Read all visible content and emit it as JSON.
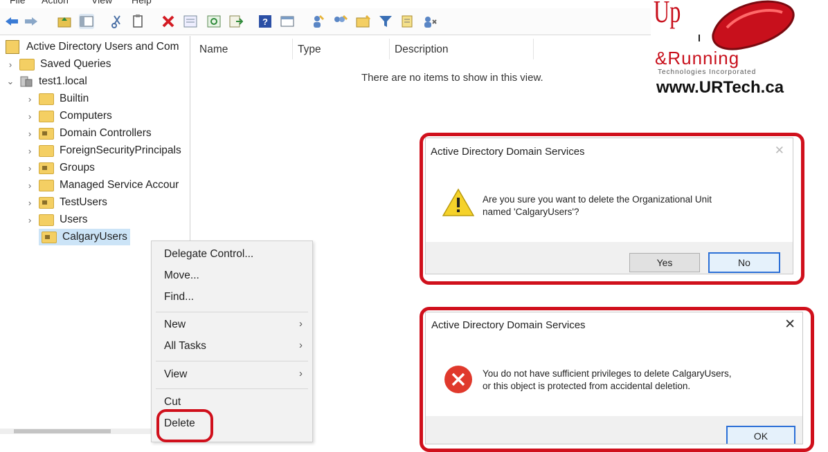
{
  "menu": [
    "File",
    "Action",
    "View",
    "Help"
  ],
  "toolbar_icons": [
    "back-icon",
    "forward-icon",
    "up-folder-icon",
    "show-tree-icon",
    "cut-icon",
    "copy-icon",
    "delete-icon",
    "properties-icon",
    "refresh-icon",
    "export-icon",
    "help-icon",
    "view-icon",
    "add-user-icon",
    "add-group-icon",
    "add-ou-icon",
    "filter-icon",
    "find-icon",
    "add-to-group-icon"
  ],
  "tree": {
    "root": "Active Directory Users and Com",
    "saved_queries": "Saved Queries",
    "domain": "test1.local",
    "children": [
      "Builtin",
      "Computers",
      "Domain Controllers",
      "ForeignSecurityPrincipals",
      "Groups",
      "Managed Service Accour",
      "TestUsers",
      "Users",
      "CalgaryUsers"
    ]
  },
  "list": {
    "columns": [
      "Name",
      "Type",
      "Description"
    ],
    "empty_message": "There are no items to show in this view."
  },
  "context_menu": {
    "delegate": "Delegate Control...",
    "move": "Move...",
    "find": "Find...",
    "new": "New",
    "all_tasks": "All Tasks",
    "view": "View",
    "cut": "Cut",
    "delete": "Delete"
  },
  "confirm_dialog": {
    "title": "Active Directory Domain Services",
    "message_line1": "Are you sure you want to delete the Organizational Unit",
    "message_line2": "named 'CalgaryUsers'?",
    "yes": "Yes",
    "no": "No"
  },
  "error_dialog": {
    "title": "Active Directory Domain Services",
    "message_line1": "You do not have sufficient privileges to delete CalgaryUsers,",
    "message_line2": "or this object is protected from accidental deletion.",
    "ok": "OK"
  },
  "logo": {
    "up": "Up",
    "running": "&Running",
    "company": "Technologies Incorporated",
    "url": "www.URTech.ca"
  },
  "colors": {
    "highlight": "#d0101c",
    "folder": "#f4cf63",
    "selection": "#cce4f7"
  }
}
